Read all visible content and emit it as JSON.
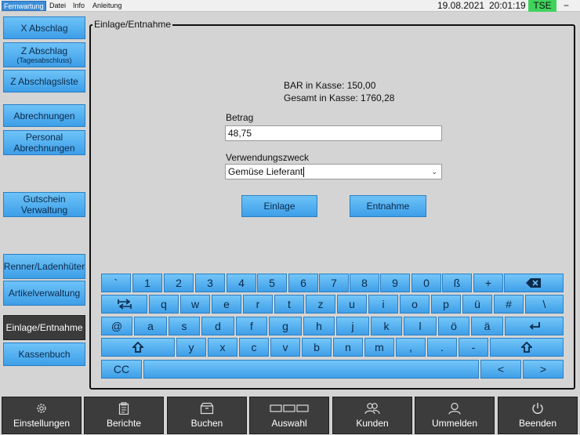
{
  "menu": {
    "items": [
      "Fernwartung",
      "Datei",
      "Info",
      "Anleitung"
    ],
    "date": "19.08.2021",
    "time": "20:01:19",
    "tse": "TSE",
    "minimize": "−"
  },
  "sidebar": {
    "x_abschlag": "X Abschlag",
    "z_abschlag": "Z Abschlag",
    "z_abschlag_sub": "(Tagesabschluss)",
    "z_liste": "Z Abschlagsliste",
    "abrechnungen": "Abrechnungen",
    "personal_1": "Personal",
    "personal_2": "Abrechnungen",
    "gutschein_1": "Gutschein",
    "gutschein_2": "Verwaltung",
    "renner": "Renner/Ladenhüter",
    "artikel": "Artikelverwaltung",
    "einlage": "Einlage/Entnahme",
    "kassenbuch": "Kassenbuch"
  },
  "main": {
    "title": "Einlage/Entnahme",
    "bar_line": "BAR in Kasse: 150,00",
    "gesamt_line": "Gesamt in Kasse: 1760,28",
    "betrag_label": "Betrag",
    "betrag_value": "48,75",
    "zweck_label": "Verwendungszweck",
    "zweck_value": "Gemüse Lieferant",
    "einlage_button": "Einlage",
    "entnahme_button": "Entnahme"
  },
  "keyboard": {
    "row1": [
      "`",
      "1",
      "2",
      "3",
      "4",
      "5",
      "6",
      "7",
      "8",
      "9",
      "0",
      "ß",
      "+"
    ],
    "row2": [
      "q",
      "w",
      "e",
      "r",
      "t",
      "z",
      "u",
      "i",
      "o",
      "p",
      "ü",
      "#",
      "\\"
    ],
    "row3": [
      "@",
      "a",
      "s",
      "d",
      "f",
      "g",
      "h",
      "j",
      "k",
      "l",
      "ö",
      "ä"
    ],
    "row4": [
      "y",
      "x",
      "c",
      "v",
      "b",
      "n",
      "m",
      ",",
      ".",
      "-"
    ],
    "cc": "CC",
    "left": "<",
    "right": ">"
  },
  "toolbar": {
    "einstellungen": "Einstellungen",
    "berichte": "Berichte",
    "buchen": "Buchen",
    "auswahl": "Auswahl",
    "kunden": "Kunden",
    "ummelden": "Ummelden",
    "beenden": "Beenden"
  }
}
